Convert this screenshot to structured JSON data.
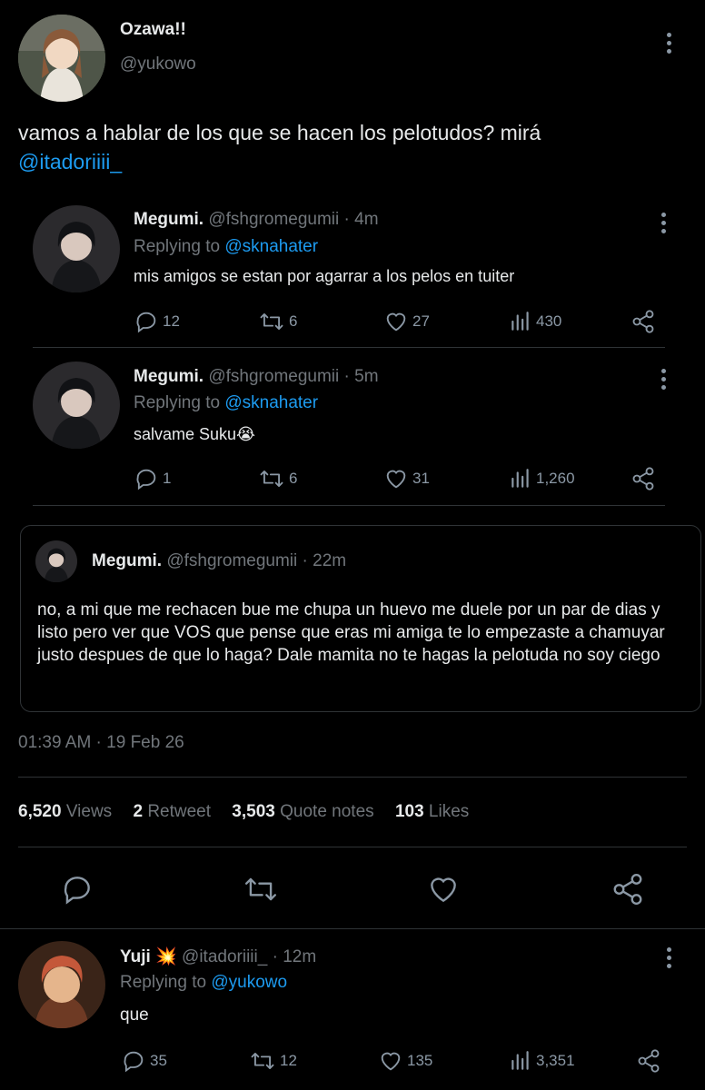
{
  "main_tweet": {
    "author_name": "Ozawa!!",
    "author_handle": "@yukowo",
    "text": "vamos a hablar de los que se hacen los pelotudos? mirá",
    "mention": "@itadoriiii_",
    "timestamp": "01:39 AM · 19 Feb 26",
    "stats": {
      "views_count": "6,520",
      "views_label": "Views",
      "retweets_count": "2",
      "retweets_label": "Retweet",
      "quotes_count": "3,503",
      "quotes_label": "Quote notes",
      "likes_count": "103",
      "likes_label": "Likes"
    }
  },
  "embedded_replies": [
    {
      "author_name": "Megumi.",
      "author_handle": "@fshgromegumii",
      "time": "· 4m",
      "replying_prefix": "Replying to",
      "replying_to": "@sknahater",
      "text": "mis amigos se estan por agarrar a los pelos en tuiter",
      "replies": "12",
      "retweets": "6",
      "likes": "27",
      "views": "430"
    },
    {
      "author_name": "Megumi.",
      "author_handle": "@fshgromegumii",
      "time": "· 5m",
      "replying_prefix": "Replying to",
      "replying_to": "@sknahater",
      "text": "salvame Suku😭",
      "replies": "1",
      "retweets": "6",
      "likes": "31",
      "views": "1,260"
    }
  ],
  "quoted_tweet": {
    "author_name": "Megumi.",
    "author_handle": "@fshgromegumii",
    "time": "· 22m",
    "text": "no, a mi que me rechacen bue me chupa un huevo me duele por un par de dias y listo pero ver que VOS que pense que eras mi amiga te lo empezaste a chamuyar justo despues de que lo haga? Dale mamita no te hagas la pelotuda no soy ciego"
  },
  "reply_tweet": {
    "author_name": "Yuji",
    "badge_emoji": "💥",
    "author_handle": "@itadoriiii_",
    "time": "· 12m",
    "replying_prefix": "Replying to",
    "replying_to": "@yukowo",
    "text": "que",
    "replies": "35",
    "retweets": "12",
    "likes": "135",
    "views": "3,351"
  },
  "colors": {
    "background": "#000000",
    "text": "#e7e9ea",
    "muted": "#71767b",
    "link": "#1d9bf0",
    "divider": "#2f3336"
  }
}
